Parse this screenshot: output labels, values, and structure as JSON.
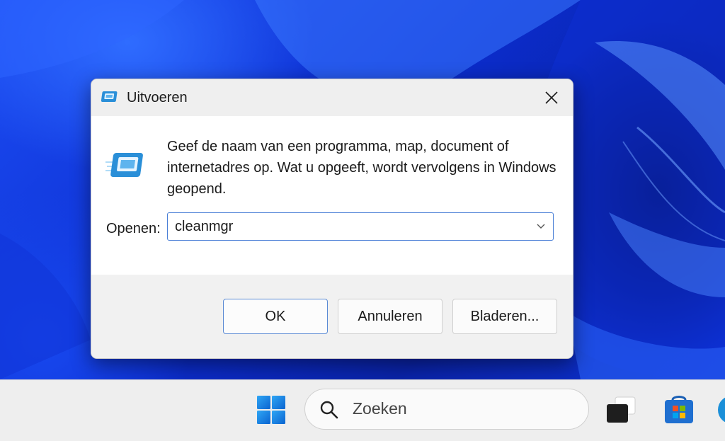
{
  "dialog": {
    "title": "Uitvoeren",
    "title_icon": "run-icon",
    "description": "Geef de naam van een programma, map, document of internetadres op. Wat u opgeeft, wordt vervolgens in Windows geopend.",
    "open_label": "Openen:",
    "open_value": "cleanmgr",
    "buttons": {
      "ok": "OK",
      "cancel": "Annuleren",
      "browse": "Bladeren..."
    }
  },
  "taskbar": {
    "search_placeholder": "Zoeken",
    "items": [
      "windows-start-icon",
      "search-icon",
      "task-view-icon",
      "microsoft-store-icon",
      "edge-icon"
    ]
  },
  "colors": {
    "accent": "#0067c0",
    "wallpaper": "#0a2fbf",
    "taskbar": "#eeeeee"
  }
}
